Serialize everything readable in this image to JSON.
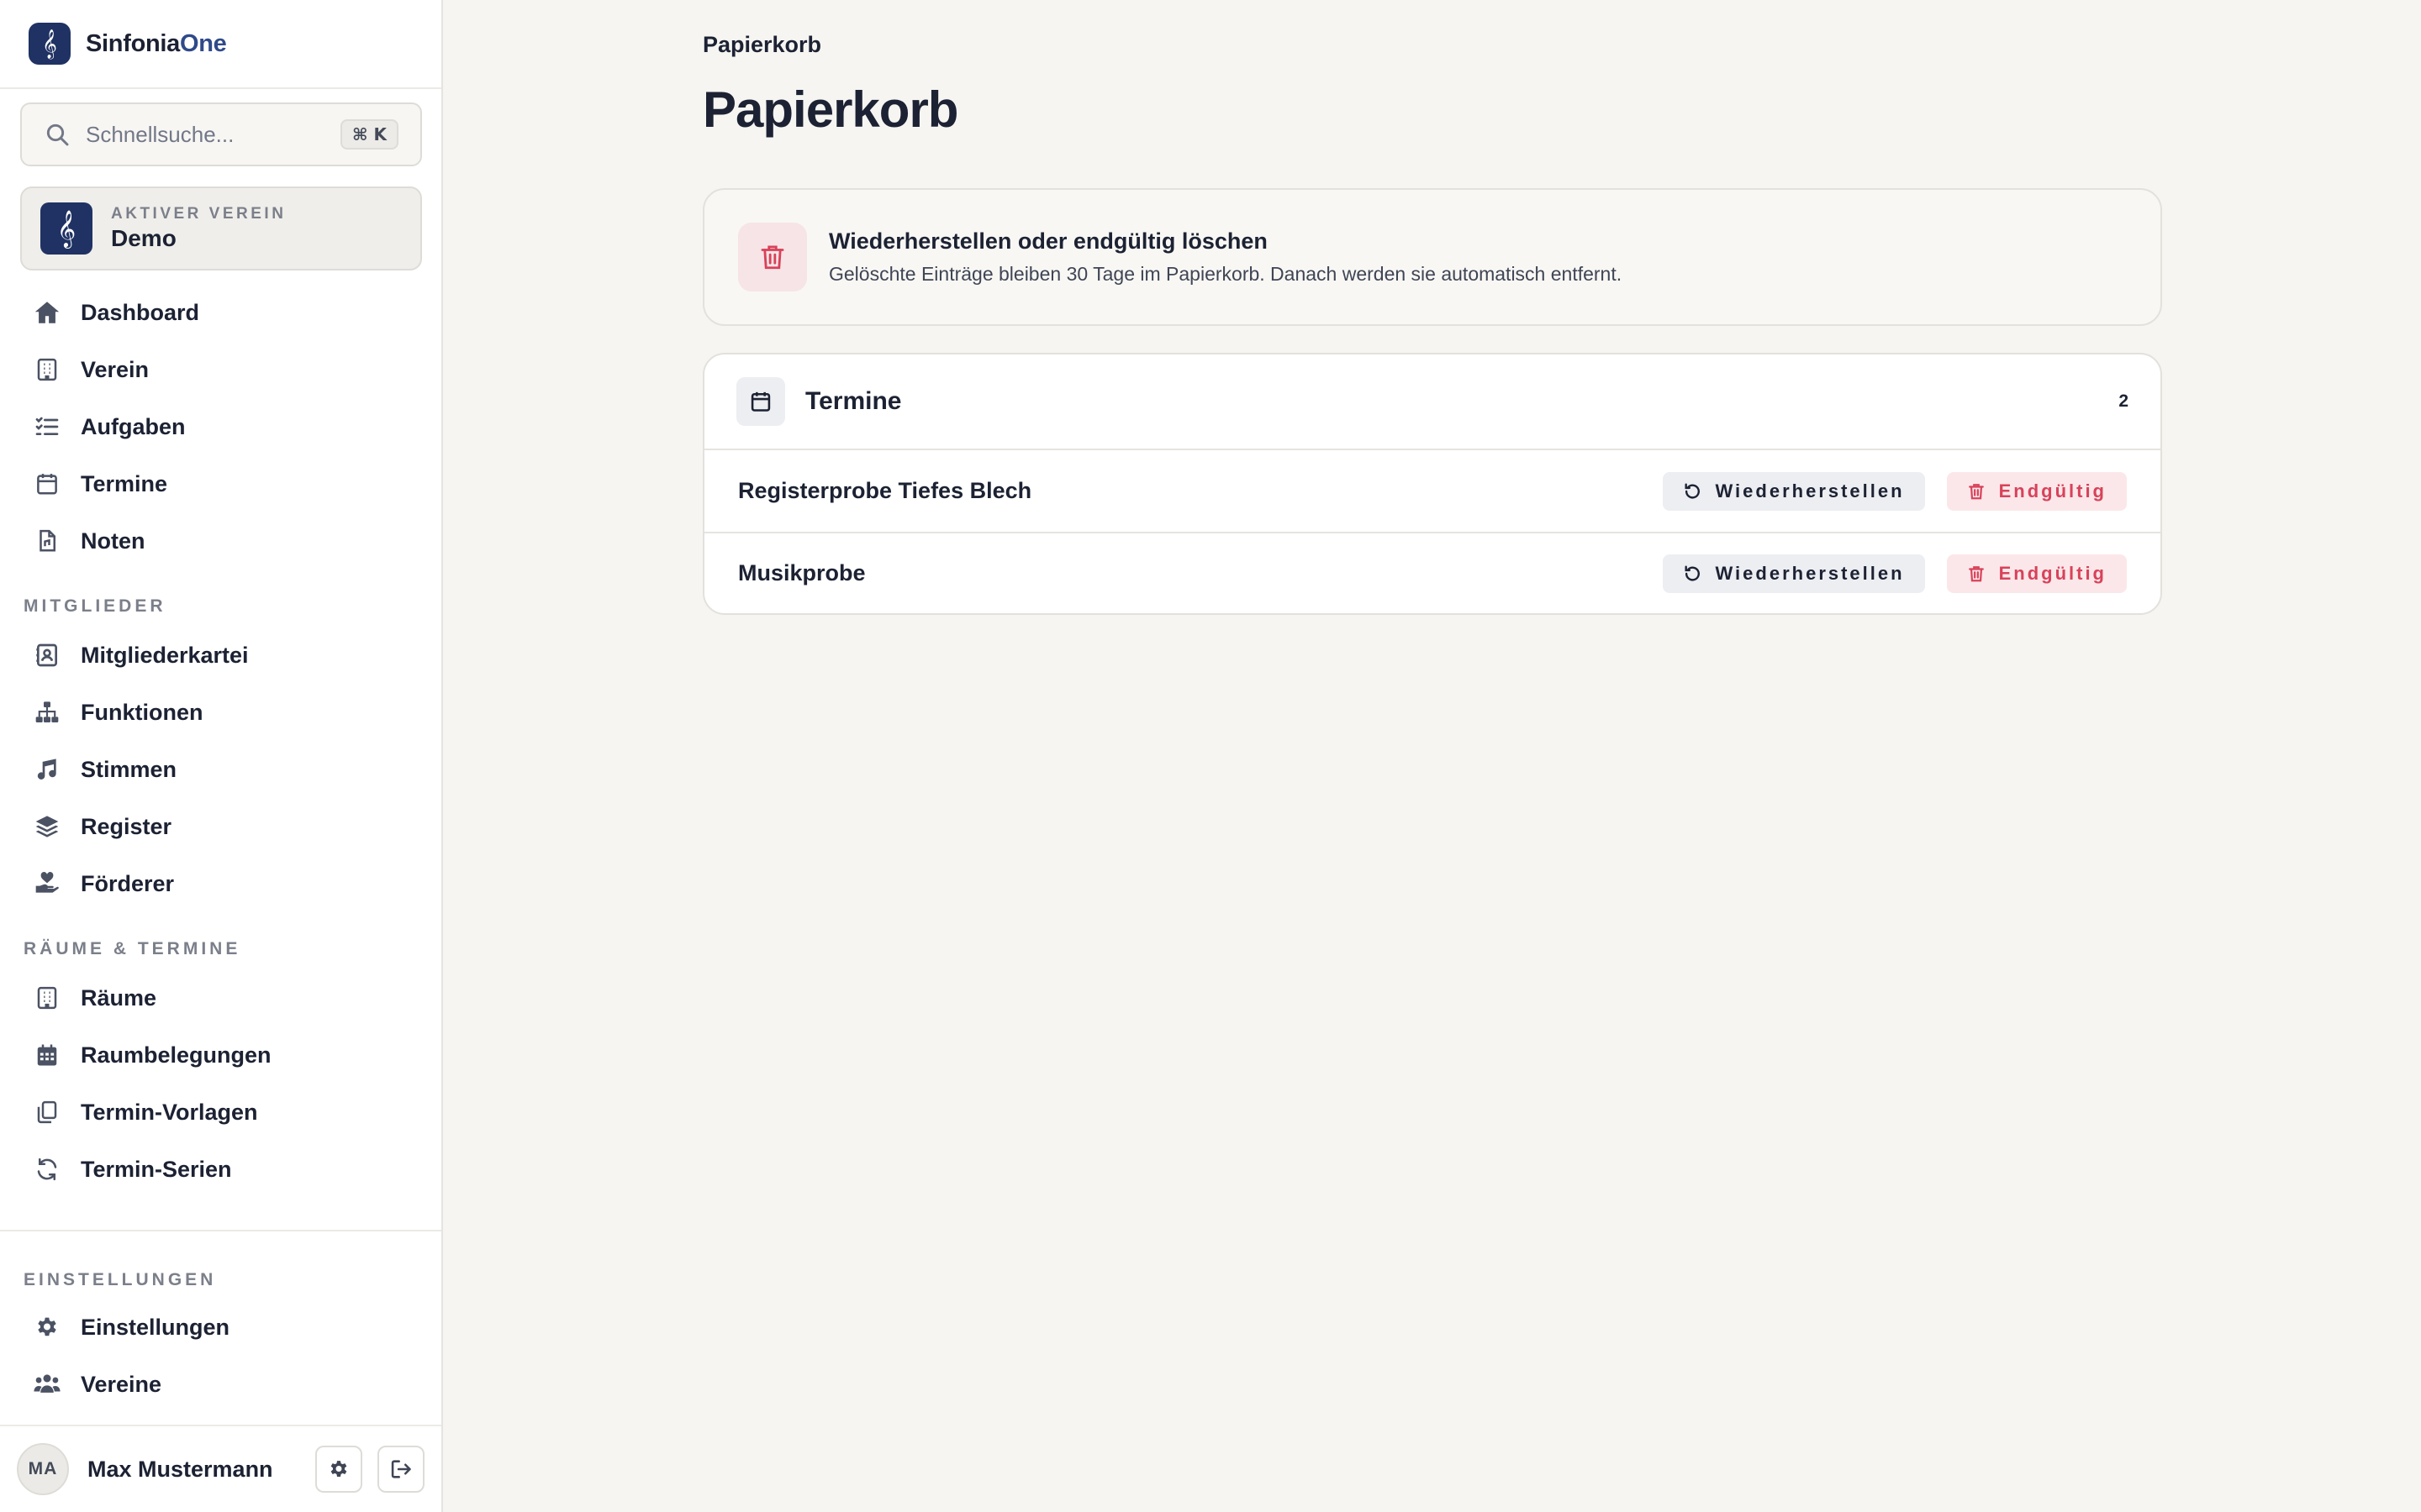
{
  "brand": {
    "name_main": "Sinfonia",
    "name_accent": "One",
    "logo_glyph": "𝄞"
  },
  "search": {
    "placeholder": "Schnellsuche...",
    "shortcut": "⌘ K"
  },
  "active_club": {
    "label": "AKTIVER VEREIN",
    "name": "Demo",
    "logo_glyph": "𝄞"
  },
  "nav": {
    "main": [
      {
        "label": "Dashboard",
        "icon": "home-icon"
      },
      {
        "label": "Verein",
        "icon": "building-icon"
      },
      {
        "label": "Aufgaben",
        "icon": "task-list-icon"
      },
      {
        "label": "Termine",
        "icon": "calendar-icon"
      },
      {
        "label": "Noten",
        "icon": "sheet-music-file-icon"
      }
    ],
    "members_section": "MITGLIEDER",
    "members": [
      {
        "label": "Mitgliederkartei",
        "icon": "contact-card-icon"
      },
      {
        "label": "Funktionen",
        "icon": "org-chart-icon"
      },
      {
        "label": "Stimmen",
        "icon": "music-note-icon"
      },
      {
        "label": "Register",
        "icon": "layers-icon"
      },
      {
        "label": "Förderer",
        "icon": "hand-heart-icon"
      }
    ],
    "rooms_section": "RÄUME & TERMINE",
    "rooms": [
      {
        "label": "Räume",
        "icon": "building-icon"
      },
      {
        "label": "Raumbelegungen",
        "icon": "calendar-grid-icon"
      },
      {
        "label": "Termin-Vorlagen",
        "icon": "copy-icon"
      },
      {
        "label": "Termin-Serien",
        "icon": "refresh-icon"
      }
    ],
    "settings_section": "EINSTELLUNGEN",
    "settings": [
      {
        "label": "Einstellungen",
        "icon": "gear-icon"
      },
      {
        "label": "Vereine",
        "icon": "users-icon"
      }
    ]
  },
  "user": {
    "initials": "MA",
    "name": "Max Mustermann"
  },
  "breadcrumb": "Papierkorb",
  "page_title": "Papierkorb",
  "info": {
    "title": "Wiederherstellen oder endgültig löschen",
    "subtitle": "Gelöschte Einträge bleiben 30 Tage im Papierkorb. Danach werden sie automatisch entfernt."
  },
  "trash_group": {
    "title": "Termine",
    "count": "2",
    "items": [
      {
        "title": "Registerprobe Tiefes Blech"
      },
      {
        "title": "Musikprobe"
      }
    ],
    "restore_label": "Wiederherstellen",
    "delete_label": "Endgültig"
  },
  "colors": {
    "accent": "#1f3263",
    "danger": "#d8425a",
    "background": "#f6f5f2"
  }
}
